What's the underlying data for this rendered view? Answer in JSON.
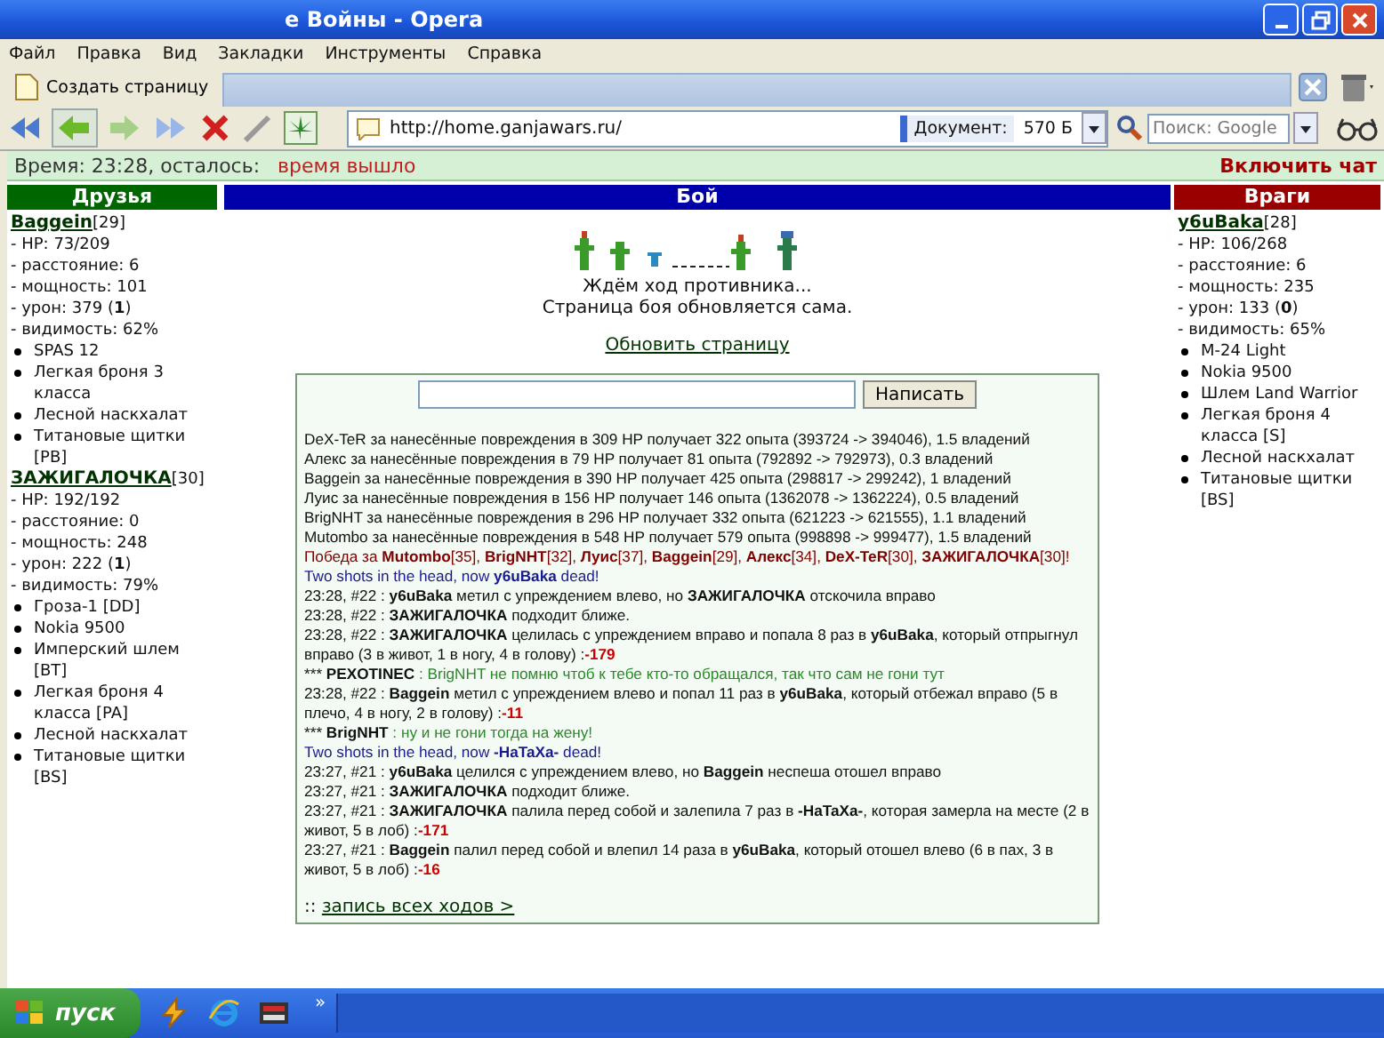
{
  "window": {
    "title": "е Войны - Opera"
  },
  "menu": [
    "Файл",
    "Правка",
    "Вид",
    "Закладки",
    "Инструменты",
    "Справка"
  ],
  "tab_bar": {
    "new_page": "Создать страницу"
  },
  "toolbar": {
    "address": "http://home.ganjawars.ru/",
    "document_label": "Документ:",
    "document_size": "570 Б",
    "search_placeholder": "Поиск: Google"
  },
  "status": {
    "time_label": "Время: 23:28, осталось:",
    "time_left": "время вышло",
    "chat_toggle": "Включить чат"
  },
  "friends": {
    "title": "Друзья",
    "players": [
      {
        "name": "Baggein",
        "level": "[29]",
        "stats": [
          "- HP: 73/209",
          "- расстояние: 6",
          "- мощность: 101",
          "- урон: 379 (**1**)",
          "- видимость: 62%"
        ],
        "items": [
          "SPAS 12",
          "Легкая броня 3 класса",
          "Лесной наскхалат",
          "Титановые щитки [PB]"
        ]
      },
      {
        "name": "ЗАЖИГАЛОЧКА",
        "level": "[30]",
        "stats": [
          "- HP: 192/192",
          "- расстояние: 0",
          "- мощность: 248",
          "- урон: 222 (**1**)",
          "- видимость: 79%"
        ],
        "items": [
          "Гроза-1 [DD]",
          "Nokia 9500",
          "Имперский шлем [BT]",
          "Легкая броня 4 класса [PA]",
          "Лесной наскхалат",
          "Титановые щитки [BS]"
        ]
      }
    ]
  },
  "battle": {
    "title": "Бой",
    "waiting": "Ждём ход противника...",
    "auto_refresh": "Страница боя обновляется сама.",
    "refresh_link": "Обновить страницу",
    "send_button": "Написать",
    "log": [
      {
        "kind": "info",
        "text": "DeX-TeR за нанесённые повреждения в 309 HP получает 322 опыта (393724 -> 394046), 1.5 владений"
      },
      {
        "kind": "info",
        "text": "Алекс за нанесённые повреждения в 79 HP получает 81 опыта (792892 -> 792973), 0.3 владений"
      },
      {
        "kind": "info",
        "text": "Baggein за нанесённые повреждения в 390 HP получает 425 опыта (298817 -> 299242), 1 владений"
      },
      {
        "kind": "info",
        "text": "Луис за нанесённые повреждения в 156 HP получает 146 опыта (1362078 -> 1362224), 0.5 владений"
      },
      {
        "kind": "info",
        "text": "BrigNHT за нанесённые повреждения в 296 HP получает 332 опыта (621223 -> 621555), 1.1 владений"
      },
      {
        "kind": "info",
        "text": "Mutombo за нанесённые повреждения в 548 HP получает 579 опыта (998898 -> 999477), 1.5 владений"
      },
      {
        "kind": "victory",
        "text": "Победа за **Mutombo**[35], **BrigNHT**[32], **Луис**[37], **Baggein**[29], **Алекс**[34], **DeX-TeR**[30], **ЗАЖИГАЛОЧКА**[30]!"
      },
      {
        "kind": "death",
        "text": "Two shots in the head, now **у6uBaka** dead!"
      },
      {
        "kind": "turn",
        "text": "23:28, #22 : **у6uBaka** метил с упреждением влево, но **ЗАЖИГАЛОЧКА** отскочила вправо"
      },
      {
        "kind": "turn",
        "text": "23:28, #22 : **ЗАЖИГАЛОЧКА** подходит ближе."
      },
      {
        "kind": "turn",
        "text": "23:28, #22 : **ЗАЖИГАЛОЧКА** целилась с упреждением вправо и попала 8 раз в **у6uBaka**, который отпрыгнул вправо (3 в живот, 1 в ногу, 4 в голову) :",
        "damage": "-179"
      },
      {
        "kind": "chat",
        "marker": "***",
        "speaker": "PEXOTINEC",
        "separator": ":",
        "message": "BrigNHT не помню чтоб к тебе кто-то обращался, так что сам не гони тут"
      },
      {
        "kind": "turn",
        "text": "23:28, #22 : **Baggein** метил с упреждением влево и попал 11 раз в **у6uBaka**, который отбежал вправо (5 в плечо, 4 в ногу, 2 в голову) :",
        "damage": "-11"
      },
      {
        "kind": "chat",
        "marker": "***",
        "speaker": "BrigNHT",
        "separator": ":",
        "message": "ну и не гони тогда на жену!"
      },
      {
        "kind": "death",
        "text": "Two shots in the head, now **-HaTaXa-** dead!"
      },
      {
        "kind": "turn",
        "text": "23:27, #21 : **у6uBaka** целился с упреждением влево, но **Baggein** неспеша отошел вправо"
      },
      {
        "kind": "turn",
        "text": "23:27, #21 : **ЗАЖИГАЛОЧКА** подходит ближе."
      },
      {
        "kind": "turn",
        "text": "23:27, #21 : **ЗАЖИГАЛОЧКА** палила перед собой и залепила 7 раз в **-HaTaXa-**, которая замерла на месте (2 в живот, 5 в лоб) :",
        "damage": "-171"
      },
      {
        "kind": "turn",
        "text": "23:27, #21 : **Baggein** палил перед собой и влепил 14 раза в **у6uBaka**, который отошел влево (6 в пах, 3 в живот, 5 в лоб) :",
        "damage": "-16"
      }
    ],
    "log_prefix": "::",
    "full_log_link": "запись всех ходов >"
  },
  "enemies": {
    "title": "Враги",
    "players": [
      {
        "name": "у6uBaka",
        "level": "[28]",
        "stats": [
          "- HP: 106/268",
          "- расстояние: 6",
          "- мощность: 235",
          "- урон: 133 (**0**)",
          "- видимость: 65%"
        ],
        "items": [
          "M-24 Light",
          "Nokia 9500",
          "Шлем Land Warrior",
          "Легкая броня 4 класса [S]",
          "Лесной наскхалат",
          "Титановые щитки [BS]"
        ]
      }
    ]
  },
  "taskbar": {
    "start": "пуск",
    "more": "»"
  }
}
